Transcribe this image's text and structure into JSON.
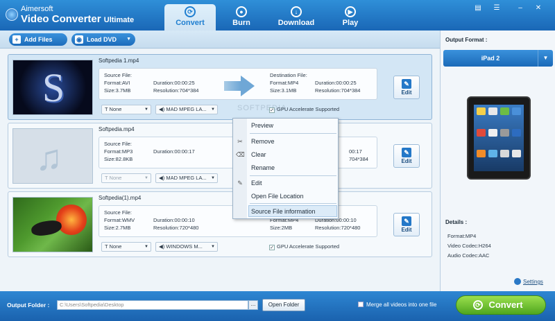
{
  "app": {
    "vendor": "Aimersoft",
    "title": "Video Converter",
    "edition": "Ultimate"
  },
  "nav_tabs": [
    {
      "label": "Convert",
      "icon": "refresh-icon",
      "active": true
    },
    {
      "label": "Burn",
      "icon": "disc-icon",
      "active": false
    },
    {
      "label": "Download",
      "icon": "download-icon",
      "active": false
    },
    {
      "label": "Play",
      "icon": "play-icon",
      "active": false
    }
  ],
  "toolbar": {
    "add_files": "Add Files",
    "load_dvd": "Load DVD"
  },
  "files": [
    {
      "name": "Softpedia 1.mp4",
      "source_label": "Source File:",
      "source_format": "Format:AVI",
      "source_duration": "Duration:00:00:25",
      "source_size": "Size:3.7MB",
      "source_resolution": "Resolution:704*384",
      "dest_label": "Destination File:",
      "dest_format": "Format:MP4",
      "dest_duration": "Duration:00:00:25",
      "dest_size": "Size:3.1MB",
      "dest_resolution": "Resolution:704*384",
      "subtitle": "None",
      "audio": "MAD MPEG LA...",
      "gpu": "GPU Accelerate Supported",
      "edit": "Edit",
      "selected": true
    },
    {
      "name": "Softpedia.mp4",
      "source_label": "Source File:",
      "source_format": "Format:MP3",
      "source_duration": "Duration:00:00:17",
      "source_size": "Size:82.8KB",
      "source_resolution": "",
      "dest_label": "",
      "dest_format": "",
      "dest_duration": "00:17",
      "dest_size": "",
      "dest_resolution": "704*384",
      "subtitle": "None",
      "audio": "MAD MPEG LA...",
      "gpu": "",
      "edit": "Edit",
      "selected": false
    },
    {
      "name": "Softpedia(1).mp4",
      "source_label": "Source File:",
      "source_format": "Format:WMV",
      "source_duration": "Duration:00:00:10",
      "source_size": "Size:2.7MB",
      "source_resolution": "Resolution:720*480",
      "dest_label": "",
      "dest_format": "Format:MP4",
      "dest_duration": "Duration:00:00:10",
      "dest_size": "Size:2MB",
      "dest_resolution": "Resolution:720*480",
      "subtitle": "None",
      "audio": "WINDOWS M...",
      "gpu": "GPU Accelerate Supported",
      "edit": "Edit",
      "selected": false
    }
  ],
  "context_menu": {
    "items": [
      "Preview",
      "Remove",
      "Clear",
      "Rename",
      "Edit",
      "Open File Location",
      "Source File information"
    ],
    "highlighted": "Source File information"
  },
  "right_panel": {
    "output_format_label": "Output Format :",
    "selected_format": "iPad 2",
    "details_label": "Details :",
    "details": [
      "Format:MP4",
      "Video Codec:H264",
      "Audio Codec:AAC"
    ],
    "settings": "Settings"
  },
  "bottom": {
    "output_folder_label": "Output Folder :",
    "output_folder_path": "C:\\Users\\Softpedia\\Desktop",
    "browse": "...",
    "open_folder": "Open Folder",
    "merge_label": "Merge all videos into one file",
    "convert": "Convert"
  },
  "watermark": "SOFTPEDIA",
  "colors": {
    "accent_blue": "#1a67b6",
    "convert_green": "#4fa61e",
    "selected_row": "#d3e6f5"
  }
}
